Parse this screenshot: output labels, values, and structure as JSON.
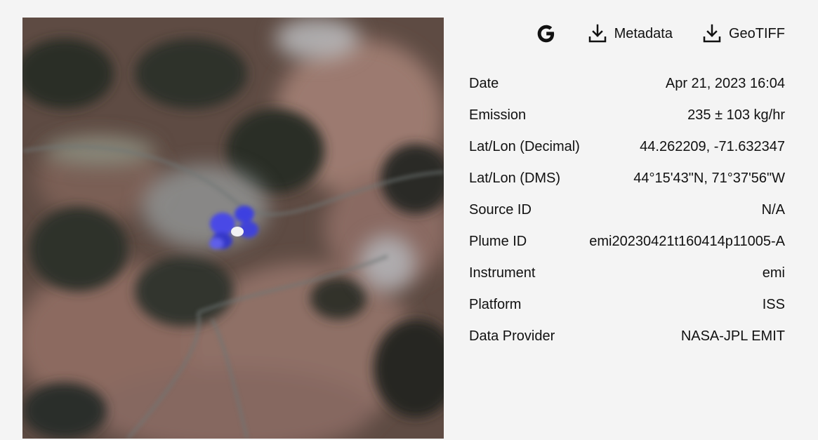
{
  "toolbar": {
    "google_icon": "google-g-icon",
    "metadata_label": "Metadata",
    "geotiff_label": "GeoTIFF",
    "download_icon": "download-icon"
  },
  "details": [
    {
      "label": "Date",
      "value": "Apr 21, 2023 16:04"
    },
    {
      "label": "Emission",
      "value": "235 ± 103 kg/hr"
    },
    {
      "label": "Lat/Lon (Decimal)",
      "value": "44.262209, -71.632347"
    },
    {
      "label": "Lat/Lon (DMS)",
      "value": "44°15'43\"N, 71°37'56\"W"
    },
    {
      "label": "Source ID",
      "value": "N/A"
    },
    {
      "label": "Plume ID",
      "value": "emi20230421t160414p11005-A"
    },
    {
      "label": "Instrument",
      "value": "emi"
    },
    {
      "label": "Platform",
      "value": "ISS"
    },
    {
      "label": "Data Provider",
      "value": "NASA-JPL EMIT"
    }
  ],
  "colors": {
    "background": "#f4f4f4",
    "text": "#111111",
    "plume": "#3d3fe0"
  }
}
